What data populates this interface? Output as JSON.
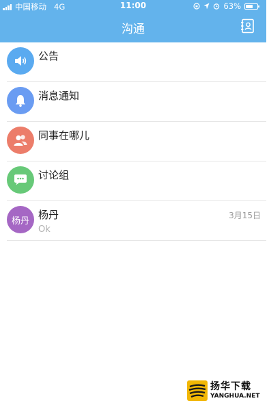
{
  "status_bar": {
    "carrier": "中国移动",
    "network": "4G",
    "time": "11:00",
    "battery": "63%",
    "battery_level": 0.63
  },
  "header": {
    "title": "沟通",
    "contacts_icon": "contacts-book-icon"
  },
  "colors": {
    "header_bg": "#63b3ec",
    "announcement": "#5aaaf0",
    "notification": "#6a9cf2",
    "colleagues": "#ec7d6a",
    "discussion": "#67c978",
    "person_avatar": "#a567c4"
  },
  "list": {
    "items": [
      {
        "title": "公告",
        "icon": "speaker-icon"
      },
      {
        "title": "消息通知",
        "icon": "bell-icon"
      },
      {
        "title": "同事在哪儿",
        "icon": "people-icon"
      },
      {
        "title": "讨论组",
        "icon": "chat-bubble-icon"
      },
      {
        "title": "杨丹",
        "avatar_text": "杨丹",
        "subtitle": "Ok",
        "date": "3月15日"
      }
    ]
  },
  "watermark": {
    "cn": "扬华下载",
    "en": "YANGHUA.NET"
  }
}
